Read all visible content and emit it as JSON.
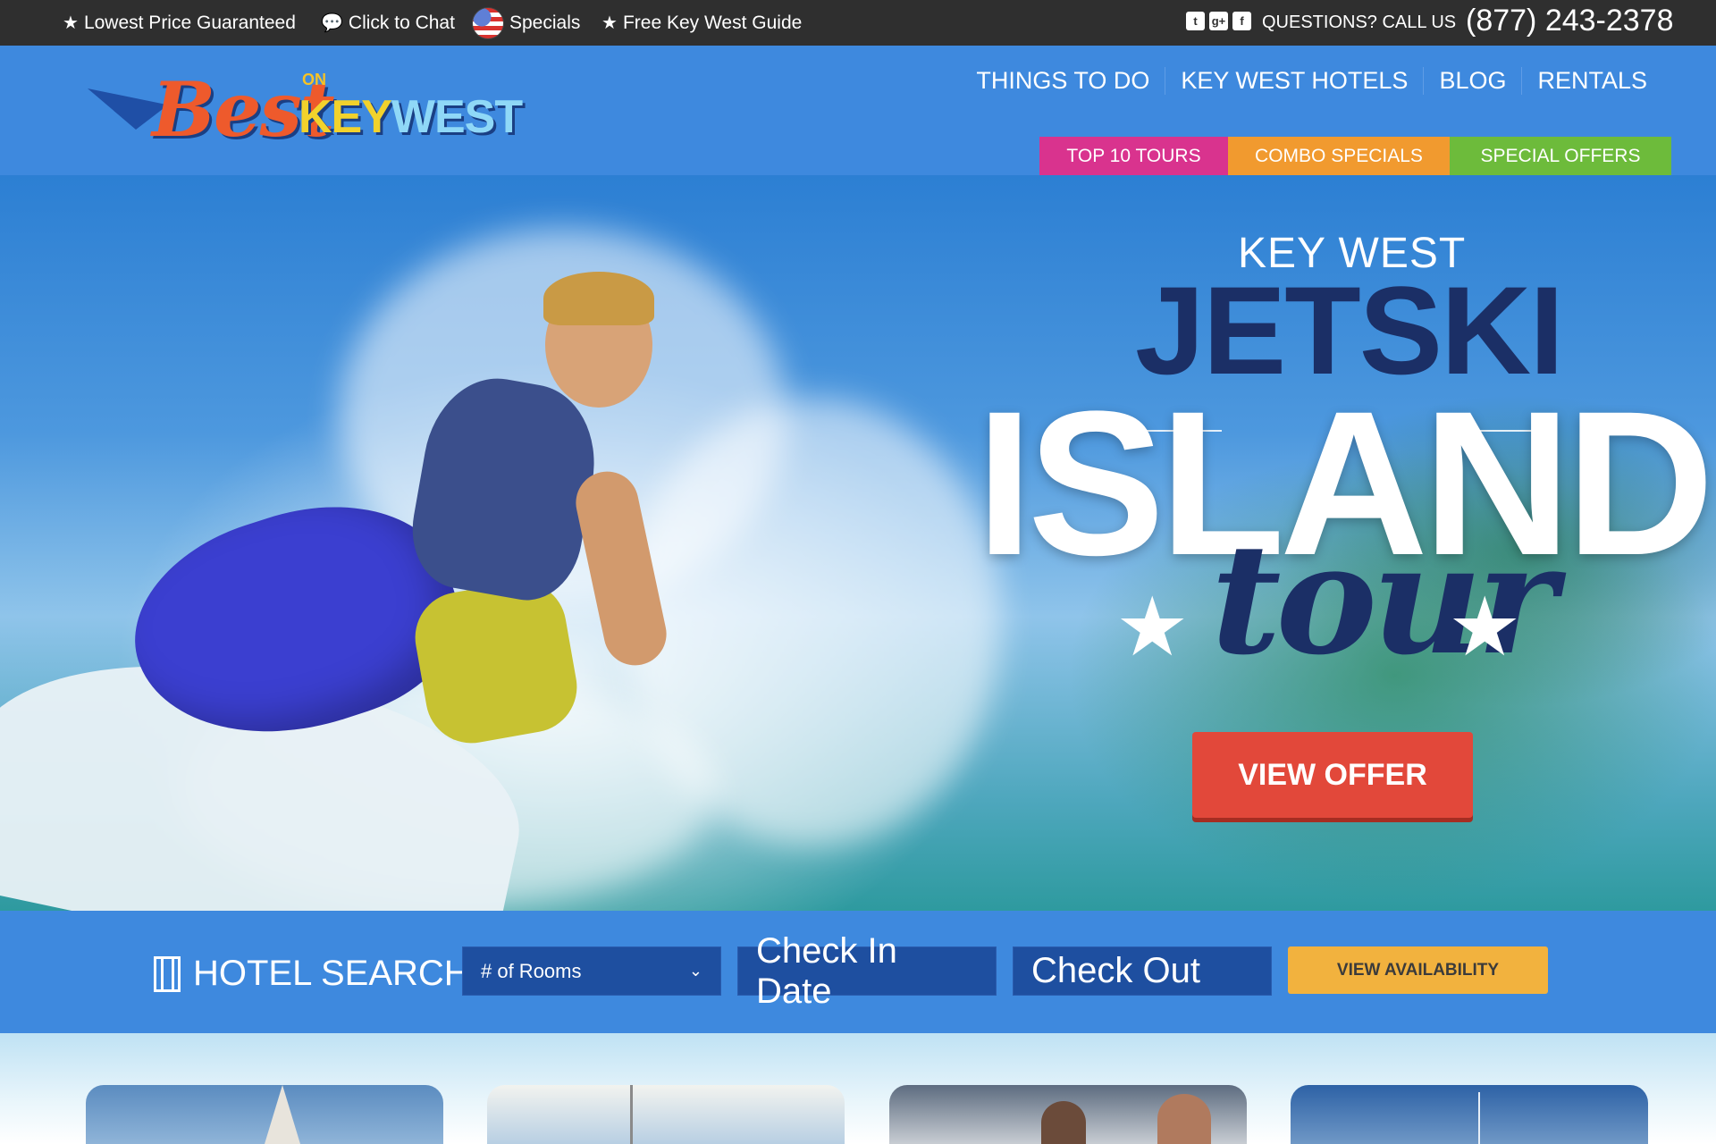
{
  "topbar": {
    "lowest_price": "Lowest Price Guaranteed",
    "chat": "Click to Chat",
    "specials": "Specials",
    "guide": "Free Key West Guide",
    "questions": "QUESTIONS? CALL US",
    "phone": "(877) 243-2378"
  },
  "header": {
    "logo": {
      "best": "Best",
      "on": "ON",
      "key": "KEY",
      "west": "WEST"
    },
    "nav": [
      "THINGS TO DO",
      "KEY WEST HOTELS",
      "BLOG",
      "RENTALS"
    ],
    "subnav": [
      "TOP 10 TOURS",
      "COMBO SPECIALS",
      "SPECIAL OFFERS"
    ]
  },
  "hero": {
    "kicker": "KEY WEST",
    "title": "JETSKI",
    "headline": "ISLAND",
    "script": "tour",
    "cta": "VIEW OFFER"
  },
  "search": {
    "label": "HOTEL SEARCH",
    "rooms_placeholder": "# of Rooms",
    "check_in": "Check In Date",
    "check_out": "Check Out",
    "submit": "VIEW AVAILABILITY"
  },
  "colors": {
    "topbar": "#2f2f2f",
    "brand_blue": "#3e89de",
    "pink": "#d9338e",
    "orange": "#f19a2f",
    "green": "#6dbb3b",
    "cta_red": "#e2483a",
    "avail_yellow": "#f2b23e"
  }
}
